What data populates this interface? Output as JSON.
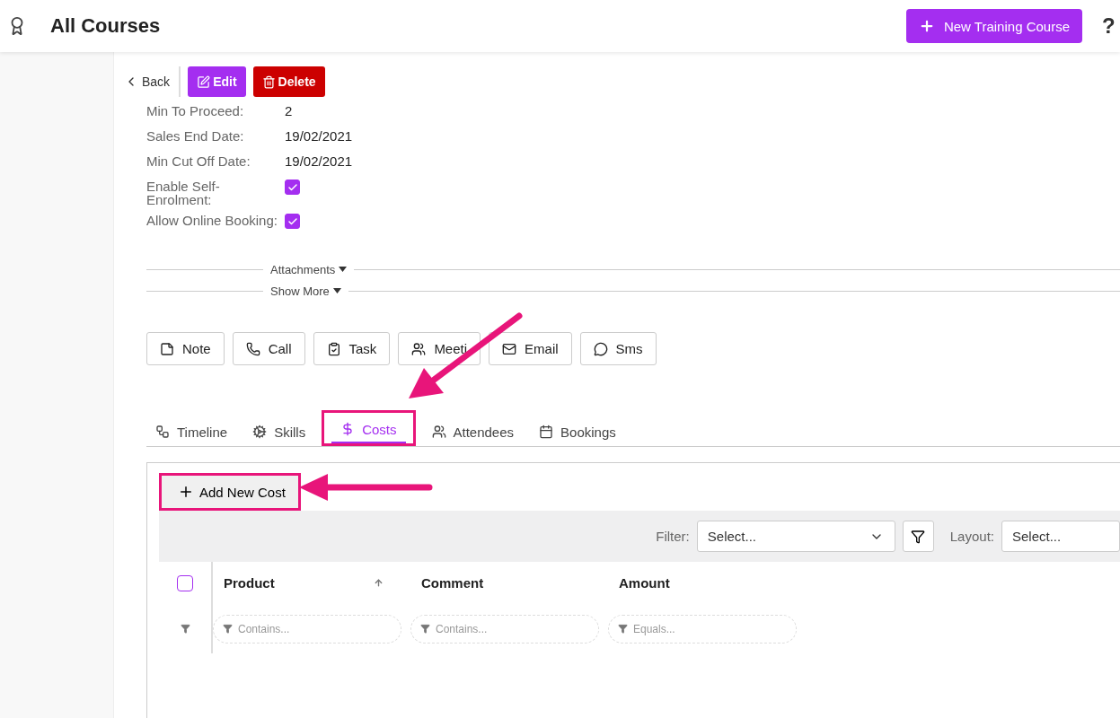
{
  "header": {
    "title": "All Courses",
    "new_button": "New Training Course",
    "help": "?"
  },
  "actions": {
    "back": "Back",
    "edit": "Edit",
    "delete": "Delete"
  },
  "fields": [
    {
      "label": "Min To Proceed:",
      "kind": "text",
      "value": "2"
    },
    {
      "label": "Sales End Date:",
      "kind": "text",
      "value": "19/02/2021"
    },
    {
      "label": "Min Cut Off Date:",
      "kind": "text",
      "value": "19/02/2021"
    },
    {
      "label": "Enable Self-Enrolment:",
      "kind": "checkbox",
      "checked": true
    },
    {
      "label": "Allow Online Booking:",
      "kind": "checkbox",
      "checked": true
    }
  ],
  "sections": [
    {
      "label": "Attachments",
      "expanded": false
    },
    {
      "label": "Show More",
      "expanded": false
    }
  ],
  "activities": [
    {
      "label": "Note",
      "kind": "note"
    },
    {
      "label": "Call",
      "kind": "call"
    },
    {
      "label": "Task",
      "kind": "task"
    },
    {
      "label": "Meeti",
      "kind": "meeting"
    },
    {
      "label": "Email",
      "kind": "email"
    },
    {
      "label": "Sms",
      "kind": "sms"
    }
  ],
  "tabs": [
    {
      "label": "Timeline",
      "kind": "timeline",
      "selected": false
    },
    {
      "label": "Skills",
      "kind": "skills",
      "selected": false
    },
    {
      "label": "Costs",
      "kind": "costs",
      "selected": true,
      "highlighted": true
    },
    {
      "label": "Attendees",
      "kind": "attendees",
      "selected": false
    },
    {
      "label": "Bookings",
      "kind": "bookings",
      "selected": false
    }
  ],
  "costs": {
    "add_button": "Add New Cost",
    "add_highlighted": true,
    "filter_label": "Filter:",
    "filter_placeholder": "Select...",
    "layout_label": "Layout:",
    "layout_placeholder": "Select...",
    "select_all": false,
    "columns": [
      {
        "label": "Product",
        "sorted": true,
        "filter_placeholder": "Contains..."
      },
      {
        "label": "Comment",
        "sorted": false,
        "filter_placeholder": "Contains..."
      },
      {
        "label": "Amount",
        "sorted": false,
        "filter_placeholder": "Equals..."
      }
    ]
  }
}
